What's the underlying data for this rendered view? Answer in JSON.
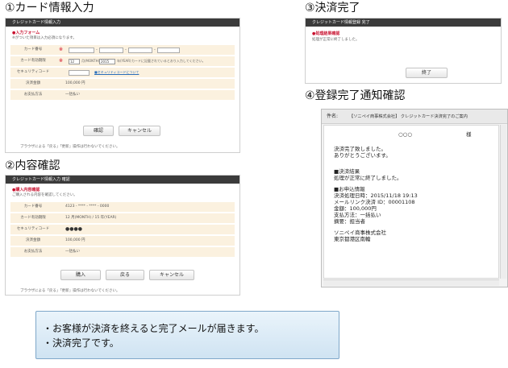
{
  "steps": {
    "card_input": "①カード情報入力",
    "confirm": "②内容確認",
    "complete": "③決済完了",
    "notify": "④登録完了通知確認"
  },
  "card_form": {
    "bar_title": "クレジットカード情報入力",
    "section_head": "●入力フォーム",
    "section_note": "※がついた項目は入力必須になります。",
    "rows": {
      "card_number": "カード番号",
      "expiry": "カード有効期限",
      "security_code": "セキュリティコード",
      "amount": "決済金額",
      "payment_method": "お支払方法"
    },
    "required_mark": "※",
    "dash": "-",
    "expiry_month": "12",
    "expiry_year": "2015",
    "expiry_month_unit": "月(MONTH)",
    "expiry_year_unit": "年(YEAR)",
    "expiry_hint": "カードに記載されているとおり入力してください。",
    "security_link": "■セキュリティコードについて",
    "amount_value": "100,000 円",
    "payment_value": "一括払い",
    "confirm_button": "確認",
    "cancel_button": "キャンセル",
    "footnote": "ブラウザによる「戻る」「更新」操作は行わないでください。"
  },
  "confirm_form": {
    "bar_title": "クレジットカード情報入力 確認",
    "section_head": "●購入内容確認",
    "section_note": "ご購入される内容を確認してください。",
    "rows": {
      "card_number": "カード番号",
      "expiry": "カード有効期限",
      "security_code": "セキュリティコード",
      "amount": "決済金額",
      "payment_method": "お支払方法"
    },
    "card_number_value": "4123 - **** - **** - 0000",
    "expiry_value": "12 月(MONTH) / 15 年(YEAR)",
    "security_value": "●●●●",
    "amount_value": "100,000 円",
    "payment_value": "一括払い",
    "buy_button": "購入",
    "back_button": "戻る",
    "cancel_button": "キャンセル",
    "footnote": "ブラウザによる「戻る」「更新」操作は行わないでください。"
  },
  "complete_panel": {
    "bar_title": "クレジットカード情報登録 完了",
    "section_head": "●処理結果確認",
    "section_note": "処理が正常に終了しました。",
    "finish_button": "終了"
  },
  "mail": {
    "subject_label": "件名:",
    "subject": "【ソニペイ商事株式会社】 クレジットカード決済完了のご案内",
    "addressee": "○○○",
    "honorific": "様",
    "body": [
      "決済完了致しました。",
      "ありがとうございます。",
      "",
      "",
      "■決済結果",
      "処理が正常に終了しました。",
      "",
      "■お申込情報",
      "決済処理日時：2015/11/18 19:13",
      "メールリンク決済 ID：00001108",
      "金額：100,000円",
      "支払方法：一括払い",
      "摘要：担当者",
      "",
      "ソニペイ商事株式会社",
      "東京都港区南輪"
    ]
  },
  "callout": {
    "line1": "・お客様が決済を終えると完了メールが届きます。",
    "line2": "・決済完了です。"
  }
}
